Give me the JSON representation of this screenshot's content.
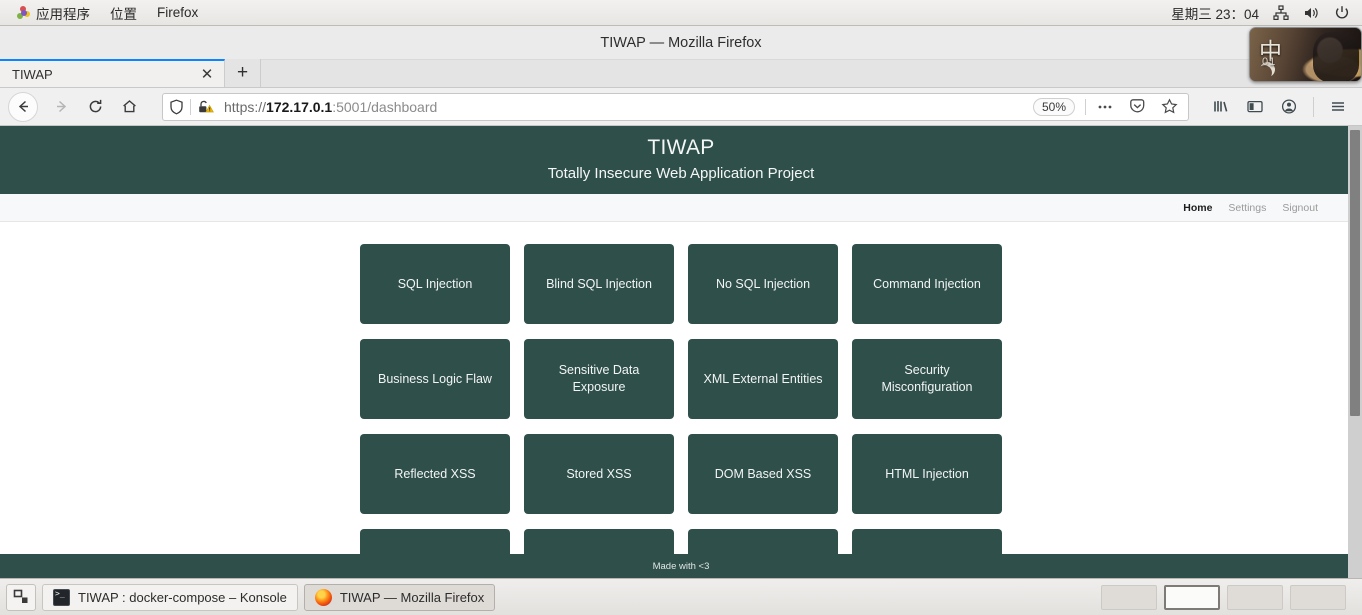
{
  "desktop": {
    "menus": [
      {
        "label": "应用程序",
        "icon": "gnome-foot-icon"
      },
      {
        "label": "位置",
        "icon": null
      },
      {
        "label": "Firefox",
        "icon": null
      }
    ],
    "clock": "星期三 23：04",
    "tray": [
      {
        "name": "network-icon",
        "glyph": "network"
      },
      {
        "name": "volume-icon",
        "glyph": "volume"
      },
      {
        "name": "power-icon",
        "glyph": "power"
      }
    ],
    "ime": {
      "glyph": "中",
      "sub": "01"
    }
  },
  "browser": {
    "window_title": "TIWAP — Mozilla Firefox",
    "tabs": [
      {
        "title": "TIWAP",
        "active": true,
        "close_label": "✕"
      }
    ],
    "new_tab_label": "+",
    "nav": {
      "back": "←",
      "forward": "→",
      "reload": "⟳",
      "home": "⌂"
    },
    "url": {
      "scheme": "https://",
      "host": "172.17.0.1",
      "path": ":5001/dashboard",
      "zoom": "50%"
    },
    "toolbar_icons": [
      {
        "name": "ellipsis-icon",
        "label": "•••"
      },
      {
        "name": "pocket-icon",
        "label": "pocket"
      },
      {
        "name": "bookmark-star-icon",
        "label": "☆"
      },
      {
        "name": "library-icon",
        "label": "library"
      },
      {
        "name": "sidebar-icon",
        "label": "sidebar"
      },
      {
        "name": "account-icon",
        "label": "account"
      },
      {
        "name": "app-menu-icon",
        "label": "☰"
      }
    ]
  },
  "page": {
    "title": "TIWAP",
    "subtitle": "Totally Insecure Web Application Project",
    "nav_links": [
      {
        "label": "Home",
        "active": true
      },
      {
        "label": "Settings",
        "active": false
      },
      {
        "label": "Signout",
        "active": false
      }
    ],
    "cards": [
      "SQL Injection",
      "Blind SQL Injection",
      "No SQL Injection",
      "Command Injection",
      "Business Logic Flaw",
      "Sensitive Data Exposure",
      "XML External Entities",
      "Security Misconfiguration",
      "Reflected XSS",
      "Stored XSS",
      "DOM Based XSS",
      "HTML Injection",
      "",
      "",
      "",
      ""
    ],
    "footer": "Made with <3",
    "colors": {
      "brand_dark": "#2f4f4a",
      "card_text": "#f2f5f4",
      "accent_tab": "#0a84ff"
    }
  },
  "taskbar": {
    "show_desktop_label": "show-desktop",
    "items": [
      {
        "label": "TIWAP : docker-compose – Konsole",
        "active": false,
        "icon": "konsole-icon"
      },
      {
        "label": "TIWAP — Mozilla Firefox",
        "active": true,
        "icon": "firefox-icon"
      }
    ],
    "workspaces": [
      {
        "active": false
      },
      {
        "active": true
      },
      {
        "active": false
      },
      {
        "active": false
      }
    ]
  }
}
